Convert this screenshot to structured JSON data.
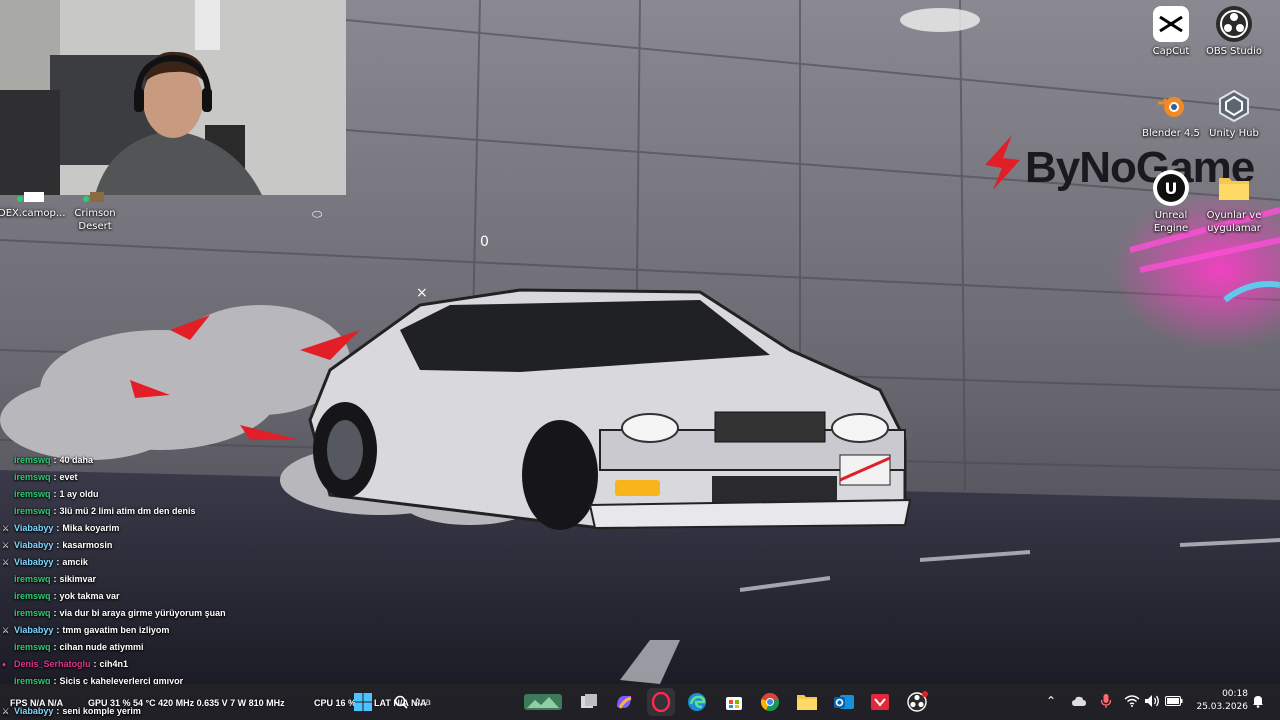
{
  "desktop": {
    "brand_logo": "ByNoGame",
    "icons": [
      {
        "label": "CapCut"
      },
      {
        "label": "OBS Studio"
      },
      {
        "label": "Blender 4.5"
      },
      {
        "label": "Unity Hub"
      },
      {
        "label": "Unreal Engine"
      },
      {
        "label": "Oyunlar ve uygulamar"
      },
      {
        "label": "DEX.camop..."
      },
      {
        "label": "Crimson Desert"
      }
    ]
  },
  "chat": {
    "messages": [
      {
        "user": "iremswq",
        "text": "40 daha",
        "user_color": "#2ecc71",
        "badge": false
      },
      {
        "user": "iremswq",
        "text": "evet",
        "user_color": "#2ecc71",
        "badge": false
      },
      {
        "user": "iremswq",
        "text": "1 ay oldu",
        "user_color": "#2ecc71",
        "badge": false
      },
      {
        "user": "iremswq",
        "text": "3lü mü 2 limi atim dm den denis",
        "user_color": "#2ecc71",
        "badge": false
      },
      {
        "user": "Viababyy",
        "text": "Mika koyarim",
        "user_color": "#7fd8ff",
        "badge": true
      },
      {
        "user": "Viababyy",
        "text": "kasarmosin",
        "user_color": "#7fd8ff",
        "badge": true
      },
      {
        "user": "Viababyy",
        "text": "amcik",
        "user_color": "#7fd8ff",
        "badge": true
      },
      {
        "user": "iremswq",
        "text": "sikimvar",
        "user_color": "#2ecc71",
        "badge": false
      },
      {
        "user": "iremswq",
        "text": "yok takma var",
        "user_color": "#2ecc71",
        "badge": false
      },
      {
        "user": "iremswq",
        "text": "via dur bi araya girme yürüyorum şuan",
        "user_color": "#2ecc71",
        "badge": false
      },
      {
        "user": "Viababyy",
        "text": "tmm gavatim ben izliyom",
        "user_color": "#7fd8ff",
        "badge": true
      },
      {
        "user": "iremswq",
        "text": "cihan nude atiymmi",
        "user_color": "#2ecc71",
        "badge": false
      },
      {
        "user": "Denis_Serhatoglu",
        "text": "cih4n1",
        "user_color": "#e0338a",
        "badge": false
      },
      {
        "user": "iremswq",
        "text": "Siçis ç kaheleyerlerçi gmıyor",
        "user_color": "#2ecc71",
        "badge": false
      },
      {
        "user": "Viababyy",
        "text": "seni komple yerim",
        "user_color": "#7fd8ff",
        "badge": true
      }
    ]
  },
  "performance": {
    "fps": "FPS N/A N/A",
    "gpu": "GPU 31 % 54 °C 420 MHz 0.635 V 7 W 810 MHz",
    "cpu": "CPU 16 %",
    "lat": "LAT N/A N/A"
  },
  "taskbar": {
    "search_placeholder": "Ara",
    "pinned": [
      "start-icon",
      "search-icon",
      "widgets-icon",
      "task-view-icon",
      "copilot-icon",
      "opera-gx-icon",
      "edge-icon",
      "store-icon",
      "chrome-icon",
      "file-explorer-icon",
      "outlook-icon",
      "vpn-icon",
      "obs-icon"
    ]
  },
  "clock": {
    "time": "00:18",
    "date": "25.03.2026"
  },
  "colors": {
    "taskbar_bg": "#1e1e24",
    "accent_red": "#e02020",
    "chat_green": "#2ecc71",
    "chat_cyan": "#7fd8ff",
    "chat_pink": "#e0338a"
  }
}
